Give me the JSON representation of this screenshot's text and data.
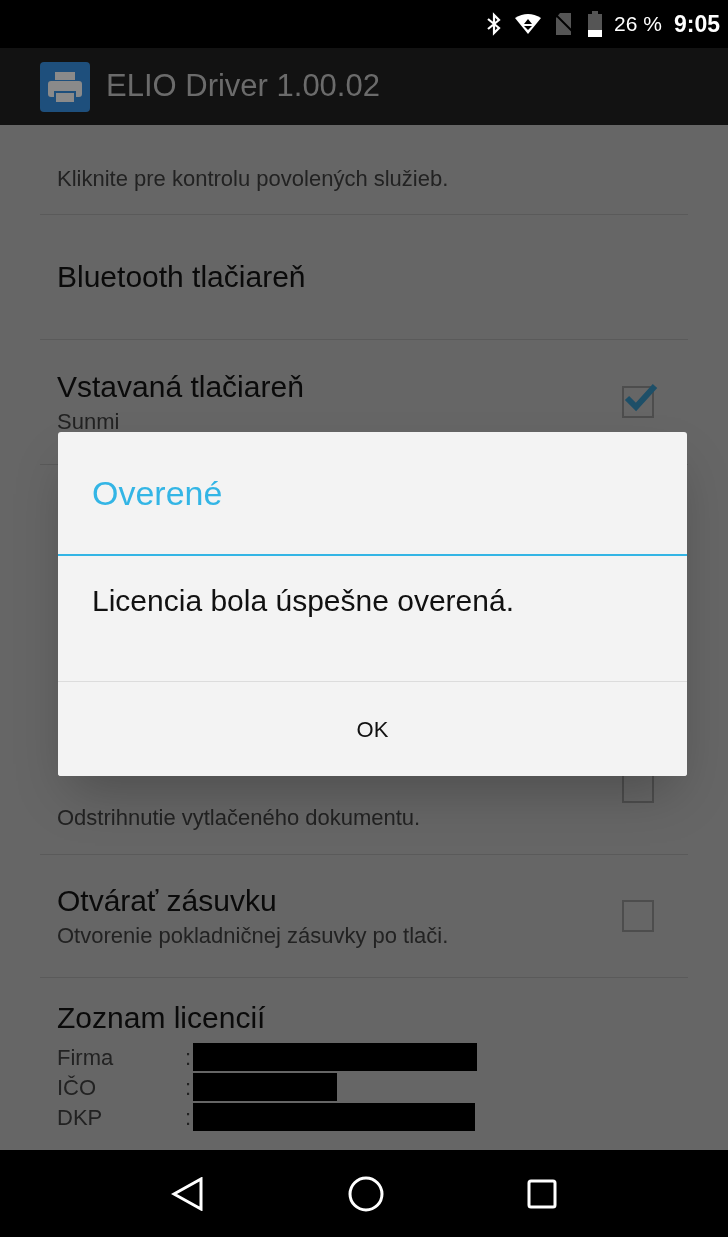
{
  "status_bar": {
    "battery": "26 %",
    "time": "9:05"
  },
  "app_bar": {
    "title": "ELIO Driver 1.00.02"
  },
  "settings_top": [
    {
      "kind": "info",
      "subtitle": "Kliknite pre kontrolu povolených služieb."
    },
    {
      "kind": "plain",
      "title": "Bluetooth tlačiareň"
    },
    {
      "kind": "checkbox",
      "title": "Vstavaná tlačiareň",
      "subtitle": "Sunmi",
      "checked": true
    }
  ],
  "settings_bottom": [
    {
      "kind": "checkbox",
      "subtitle": "Odstrihnutie vytlačeného dokumentu.",
      "checked": false
    },
    {
      "kind": "checkbox",
      "title": "Otvárať zásuvku",
      "subtitle": "Otvorenie pokladničnej zásuvky po tlači.",
      "checked": false
    }
  ],
  "licenses": {
    "title": "Zoznam licencií",
    "rows": [
      {
        "label": "Firma",
        "separator": ":"
      },
      {
        "label": "IČO",
        "separator": ":"
      },
      {
        "label": "DKP",
        "separator": ":"
      }
    ]
  },
  "dialog": {
    "title": "Overené",
    "message": "Licencia bola úspešne overená.",
    "button": "OK"
  }
}
